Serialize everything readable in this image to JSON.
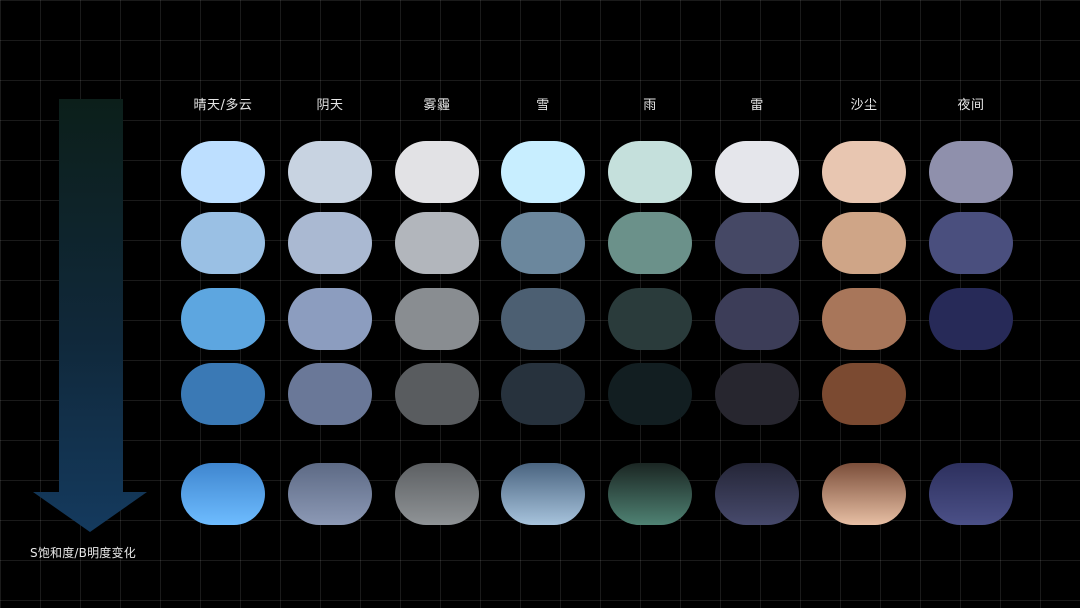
{
  "arrow": {
    "caption": "S饱和度/B明度变化"
  },
  "palette": {
    "columns": [
      {
        "label": "晴天/多云",
        "swatches": [
          "#bddfff",
          "#9ac0e4",
          "#5da6e0",
          "#3a79b5"
        ],
        "gradient": [
          "#3f86cf",
          "#6ebcff"
        ]
      },
      {
        "label": "阴天",
        "swatches": [
          "#c8d3e1",
          "#aab9d2",
          "#8c9dbf",
          "#6a7898"
        ],
        "gradient": [
          "#5d6a85",
          "#8c99b5"
        ]
      },
      {
        "label": "雾霾",
        "swatches": [
          "#e2e2e5",
          "#b2b6bc",
          "#898d91",
          "#595c5f"
        ],
        "gradient": [
          "#5d6063",
          "#8f9396"
        ]
      },
      {
        "label": "雪",
        "swatches": [
          "#c8eeff",
          "#6b879d",
          "#4c5f72",
          "#27323d"
        ],
        "gradient": [
          "#4a6480",
          "#a7c3dc"
        ]
      },
      {
        "label": "雨",
        "swatches": [
          "#c5e0dc",
          "#6b918a",
          "#2a3b3b",
          "#121e21"
        ],
        "gradient": [
          "#1b2623",
          "#4f8273"
        ]
      },
      {
        "label": "雷",
        "swatches": [
          "#e5e6eb",
          "#454865",
          "#3c3d58",
          "#27262f"
        ],
        "gradient": [
          "#252638",
          "#474a6c"
        ]
      },
      {
        "label": "沙尘",
        "swatches": [
          "#e8c6b1",
          "#cfa587",
          "#a8765a",
          "#7b4a31"
        ],
        "gradient": [
          "#7b4e3a",
          "#e7bfa4"
        ]
      },
      {
        "label": "夜间",
        "swatches": [
          "#8f90ac",
          "#4a4f7e",
          "#272a58",
          null
        ],
        "gradient": [
          "#2d305e",
          "#4b5087"
        ]
      }
    ]
  }
}
